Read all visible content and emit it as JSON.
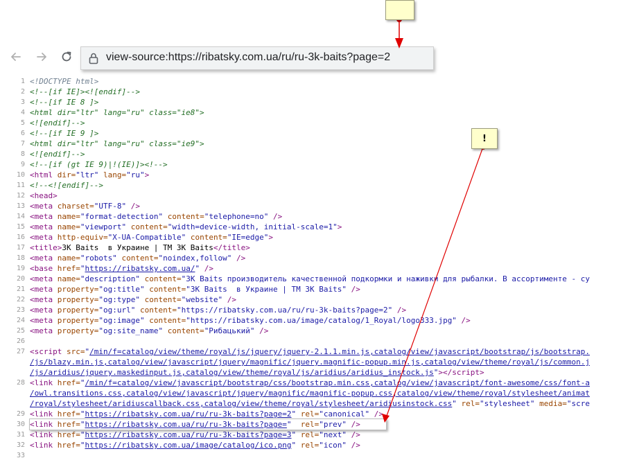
{
  "browser": {
    "address": "view-source:https://ribatsky.com.ua/ru/ru-3k-baits?page=2",
    "icons": {
      "back": "back-arrow-icon",
      "forward": "forward-arrow-icon",
      "reload": "reload-icon",
      "lock": "lock-icon"
    }
  },
  "notes": {
    "top_note": "",
    "mid_note": "!"
  },
  "source_lines": [
    {
      "n": "1",
      "code": [
        {
          "t": "<!DOCTYPE html>",
          "c": "c-doctype"
        }
      ]
    },
    {
      "n": "2",
      "code": [
        {
          "t": "<!--[if IE]><![endif]-->",
          "c": "c-comment"
        }
      ]
    },
    {
      "n": "3",
      "code": [
        {
          "t": "<!--[if IE 8 ]>",
          "c": "c-comment"
        }
      ]
    },
    {
      "n": "4",
      "code": [
        {
          "t": "<html dir=\"ltr\" lang=\"ru\" class=\"ie8\">",
          "c": "c-comment"
        }
      ]
    },
    {
      "n": "5",
      "code": [
        {
          "t": "<![endif]-->",
          "c": "c-comment"
        }
      ]
    },
    {
      "n": "6",
      "code": [
        {
          "t": "<!--[if IE 9 ]>",
          "c": "c-comment"
        }
      ]
    },
    {
      "n": "7",
      "code": [
        {
          "t": "<html dir=\"ltr\" lang=\"ru\" class=\"ie9\">",
          "c": "c-comment"
        }
      ]
    },
    {
      "n": "8",
      "code": [
        {
          "t": "<![endif]-->",
          "c": "c-comment"
        }
      ]
    },
    {
      "n": "9",
      "code": [
        {
          "t": "<!--[if (gt IE 9)|!(IE)]><!-->",
          "c": "c-comment"
        }
      ]
    },
    {
      "n": "10",
      "code": [
        {
          "t": "<html ",
          "c": "c-tag"
        },
        {
          "t": "dir=",
          "c": "c-attr"
        },
        {
          "t": "\"ltr\"",
          "c": "c-val"
        },
        {
          "t": " lang=",
          "c": "c-attr"
        },
        {
          "t": "\"ru\"",
          "c": "c-val"
        },
        {
          "t": ">",
          "c": "c-tag"
        }
      ]
    },
    {
      "n": "11",
      "code": [
        {
          "t": "<!--<![endif]-->",
          "c": "c-comment"
        }
      ]
    },
    {
      "n": "12",
      "code": [
        {
          "t": "<head>",
          "c": "c-tag"
        }
      ]
    },
    {
      "n": "13",
      "code": [
        {
          "t": "<meta ",
          "c": "c-tag"
        },
        {
          "t": "charset=",
          "c": "c-attr"
        },
        {
          "t": "\"UTF-8\"",
          "c": "c-val"
        },
        {
          "t": " />",
          "c": "c-tag"
        }
      ]
    },
    {
      "n": "14",
      "code": [
        {
          "t": "<meta ",
          "c": "c-tag"
        },
        {
          "t": "name=",
          "c": "c-attr"
        },
        {
          "t": "\"format-detection\"",
          "c": "c-val"
        },
        {
          "t": " content=",
          "c": "c-attr"
        },
        {
          "t": "\"telephone=no\"",
          "c": "c-val"
        },
        {
          "t": " />",
          "c": "c-tag"
        }
      ]
    },
    {
      "n": "15",
      "code": [
        {
          "t": "<meta ",
          "c": "c-tag"
        },
        {
          "t": "name=",
          "c": "c-attr"
        },
        {
          "t": "\"viewport\"",
          "c": "c-val"
        },
        {
          "t": " content=",
          "c": "c-attr"
        },
        {
          "t": "\"width=device-width, initial-scale=1\"",
          "c": "c-val"
        },
        {
          "t": ">",
          "c": "c-tag"
        }
      ]
    },
    {
      "n": "16",
      "code": [
        {
          "t": "<meta ",
          "c": "c-tag"
        },
        {
          "t": "http-equiv=",
          "c": "c-attr"
        },
        {
          "t": "\"X-UA-Compatible\"",
          "c": "c-val"
        },
        {
          "t": " content=",
          "c": "c-attr"
        },
        {
          "t": "\"IE=edge\"",
          "c": "c-val"
        },
        {
          "t": ">",
          "c": "c-tag"
        }
      ]
    },
    {
      "n": "17",
      "code": [
        {
          "t": "<title>",
          "c": "c-tag"
        },
        {
          "t": "3K Baits  в Украине | ТМ 3K Baits",
          "c": ""
        },
        {
          "t": "</title>",
          "c": "c-tag"
        }
      ]
    },
    {
      "n": "18",
      "code": [
        {
          "t": "<meta ",
          "c": "c-tag"
        },
        {
          "t": "name=",
          "c": "c-attr"
        },
        {
          "t": "\"robots\"",
          "c": "c-val"
        },
        {
          "t": " content=",
          "c": "c-attr"
        },
        {
          "t": "\"noindex,follow\"",
          "c": "c-val"
        },
        {
          "t": " />",
          "c": "c-tag"
        }
      ]
    },
    {
      "n": "19",
      "code": [
        {
          "t": "<base ",
          "c": "c-tag"
        },
        {
          "t": "href=",
          "c": "c-attr"
        },
        {
          "t": "\"",
          "c": "c-val"
        },
        {
          "t": "https://ribatsky.com.ua/",
          "c": "c-link"
        },
        {
          "t": "\"",
          "c": "c-val"
        },
        {
          "t": " />",
          "c": "c-tag"
        }
      ]
    },
    {
      "n": "20",
      "code": [
        {
          "t": "<meta ",
          "c": "c-tag"
        },
        {
          "t": "name=",
          "c": "c-attr"
        },
        {
          "t": "\"description\"",
          "c": "c-val"
        },
        {
          "t": " content=",
          "c": "c-attr"
        },
        {
          "t": "\"3K Baits производитель качественной подкормки и наживки для рыбалки. В ассортименте - су",
          "c": "c-val"
        }
      ]
    },
    {
      "n": "21",
      "code": [
        {
          "t": "<meta ",
          "c": "c-tag"
        },
        {
          "t": "property=",
          "c": "c-attr"
        },
        {
          "t": "\"og:title\"",
          "c": "c-val"
        },
        {
          "t": " content=",
          "c": "c-attr"
        },
        {
          "t": "\"3K Baits  в Украине | ТМ 3K Baits\"",
          "c": "c-val"
        },
        {
          "t": " />",
          "c": "c-tag"
        }
      ]
    },
    {
      "n": "22",
      "code": [
        {
          "t": "<meta ",
          "c": "c-tag"
        },
        {
          "t": "property=",
          "c": "c-attr"
        },
        {
          "t": "\"og:type\"",
          "c": "c-val"
        },
        {
          "t": " content=",
          "c": "c-attr"
        },
        {
          "t": "\"website\"",
          "c": "c-val"
        },
        {
          "t": " />",
          "c": "c-tag"
        }
      ]
    },
    {
      "n": "23",
      "code": [
        {
          "t": "<meta ",
          "c": "c-tag"
        },
        {
          "t": "property=",
          "c": "c-attr"
        },
        {
          "t": "\"og:url\"",
          "c": "c-val"
        },
        {
          "t": " content=",
          "c": "c-attr"
        },
        {
          "t": "\"https://ribatsky.com.ua/ru/ru-3k-baits?page=2\"",
          "c": "c-val"
        },
        {
          "t": " />",
          "c": "c-tag"
        }
      ]
    },
    {
      "n": "24",
      "code": [
        {
          "t": "<meta ",
          "c": "c-tag"
        },
        {
          "t": "property=",
          "c": "c-attr"
        },
        {
          "t": "\"og:image\"",
          "c": "c-val"
        },
        {
          "t": " content=",
          "c": "c-attr"
        },
        {
          "t": "\"https://ribatsky.com.ua/image/catalog/1_Royal/logo333.jpg\"",
          "c": "c-val"
        },
        {
          "t": " />",
          "c": "c-tag"
        }
      ]
    },
    {
      "n": "25",
      "code": [
        {
          "t": "<meta ",
          "c": "c-tag"
        },
        {
          "t": "property=",
          "c": "c-attr"
        },
        {
          "t": "\"og:site_name\"",
          "c": "c-val"
        },
        {
          "t": " content=",
          "c": "c-attr"
        },
        {
          "t": "\"Рибацький\"",
          "c": "c-val"
        },
        {
          "t": " />",
          "c": "c-tag"
        }
      ]
    },
    {
      "n": "26",
      "code": []
    },
    {
      "n": "27",
      "code": [
        {
          "t": "<script ",
          "c": "c-tag"
        },
        {
          "t": "src=",
          "c": "c-attr"
        },
        {
          "t": "\"",
          "c": "c-val"
        },
        {
          "t": "/min/f=catalog/view/theme/royal/js/jquery/jquery-2.1.1.min.js,catalog/view/javascript/bootstrap/js/bootstrap.",
          "c": "c-link"
        }
      ]
    },
    {
      "n": "",
      "code": [
        {
          "t": "/js/blazy.min.js,catalog/view/javascript/jquery/magnific/jquery.magnific-popup.min.js,catalog/view/theme/royal/js/common.j",
          "c": "c-link"
        }
      ]
    },
    {
      "n": "",
      "code": [
        {
          "t": "/js/aridius/jquery.maskedinput.js,catalog/view/theme/royal/js/aridius/aridius_instock.js",
          "c": "c-link"
        },
        {
          "t": "\"",
          "c": "c-val"
        },
        {
          "t": "></",
          "c": "c-tag"
        },
        {
          "t": "script",
          "c": "c-tag"
        },
        {
          "t": ">",
          "c": "c-tag"
        }
      ]
    },
    {
      "n": "28",
      "code": [
        {
          "t": "<link ",
          "c": "c-tag"
        },
        {
          "t": "href=",
          "c": "c-attr"
        },
        {
          "t": "\"",
          "c": "c-val"
        },
        {
          "t": "/min/f=catalog/view/javascript/bootstrap/css/bootstrap.min.css,catalog/view/javascript/font-awesome/css/font-a",
          "c": "c-link"
        }
      ]
    },
    {
      "n": "",
      "code": [
        {
          "t": "/owl.transitions.css,catalog/view/javascript/jquery/magnific/magnific-popup.css,catalog/view/theme/royal/stylesheet/animat",
          "c": "c-link"
        }
      ]
    },
    {
      "n": "",
      "code": [
        {
          "t": "/royal/stylesheet/aridiuscallback.css,catalog/view/theme/royal/stylesheet/aridiusinstock.css",
          "c": "c-link"
        },
        {
          "t": "\"",
          "c": "c-val"
        },
        {
          "t": " rel=",
          "c": "c-attr"
        },
        {
          "t": "\"stylesheet\"",
          "c": "c-val"
        },
        {
          "t": " media=",
          "c": "c-attr"
        },
        {
          "t": "\"scre",
          "c": "c-val"
        }
      ]
    },
    {
      "n": "29",
      "code": [
        {
          "t": "<link ",
          "c": "c-tag"
        },
        {
          "t": "href=",
          "c": "c-attr"
        },
        {
          "t": "\"",
          "c": "c-val"
        },
        {
          "t": "https://ribatsky.com.ua/ru/ru-3k-baits?page=2",
          "c": "c-link"
        },
        {
          "t": "\"",
          "c": "c-val"
        },
        {
          "t": " rel=",
          "c": "c-attr"
        },
        {
          "t": "\"canonical\"",
          "c": "c-val"
        },
        {
          "t": " />",
          "c": "c-tag"
        }
      ]
    },
    {
      "n": "30",
      "code": [
        {
          "t": "<link ",
          "c": "c-tag"
        },
        {
          "t": "href=",
          "c": "c-attr"
        },
        {
          "t": "\"",
          "c": "c-val"
        },
        {
          "t": "https://ribatsky.com.ua/ru/ru-3k-baits?page=",
          "c": "c-link"
        },
        {
          "t": "\"",
          "c": "c-val"
        },
        {
          "t": "  rel=",
          "c": "c-attr"
        },
        {
          "t": "\"prev\"",
          "c": "c-val"
        },
        {
          "t": " />",
          "c": "c-tag"
        }
      ]
    },
    {
      "n": "31",
      "code": [
        {
          "t": "<link ",
          "c": "c-tag"
        },
        {
          "t": "href=",
          "c": "c-attr"
        },
        {
          "t": "\"",
          "c": "c-val"
        },
        {
          "t": "https://ribatsky.com.ua/ru/ru-3k-baits?page=3",
          "c": "c-link"
        },
        {
          "t": "\"",
          "c": "c-val"
        },
        {
          "t": " rel=",
          "c": "c-attr"
        },
        {
          "t": "\"next\"",
          "c": "c-val"
        },
        {
          "t": " />",
          "c": "c-tag"
        }
      ]
    },
    {
      "n": "32",
      "code": [
        {
          "t": "<link ",
          "c": "c-tag"
        },
        {
          "t": "href=",
          "c": "c-attr"
        },
        {
          "t": "\"",
          "c": "c-val"
        },
        {
          "t": "https://ribatsky.com.ua/image/catalog/ico.png",
          "c": "c-link"
        },
        {
          "t": "\"",
          "c": "c-val"
        },
        {
          "t": " rel=",
          "c": "c-attr"
        },
        {
          "t": "\"icon\"",
          "c": "c-val"
        },
        {
          "t": " />",
          "c": "c-tag"
        }
      ]
    },
    {
      "n": "33",
      "code": []
    }
  ]
}
